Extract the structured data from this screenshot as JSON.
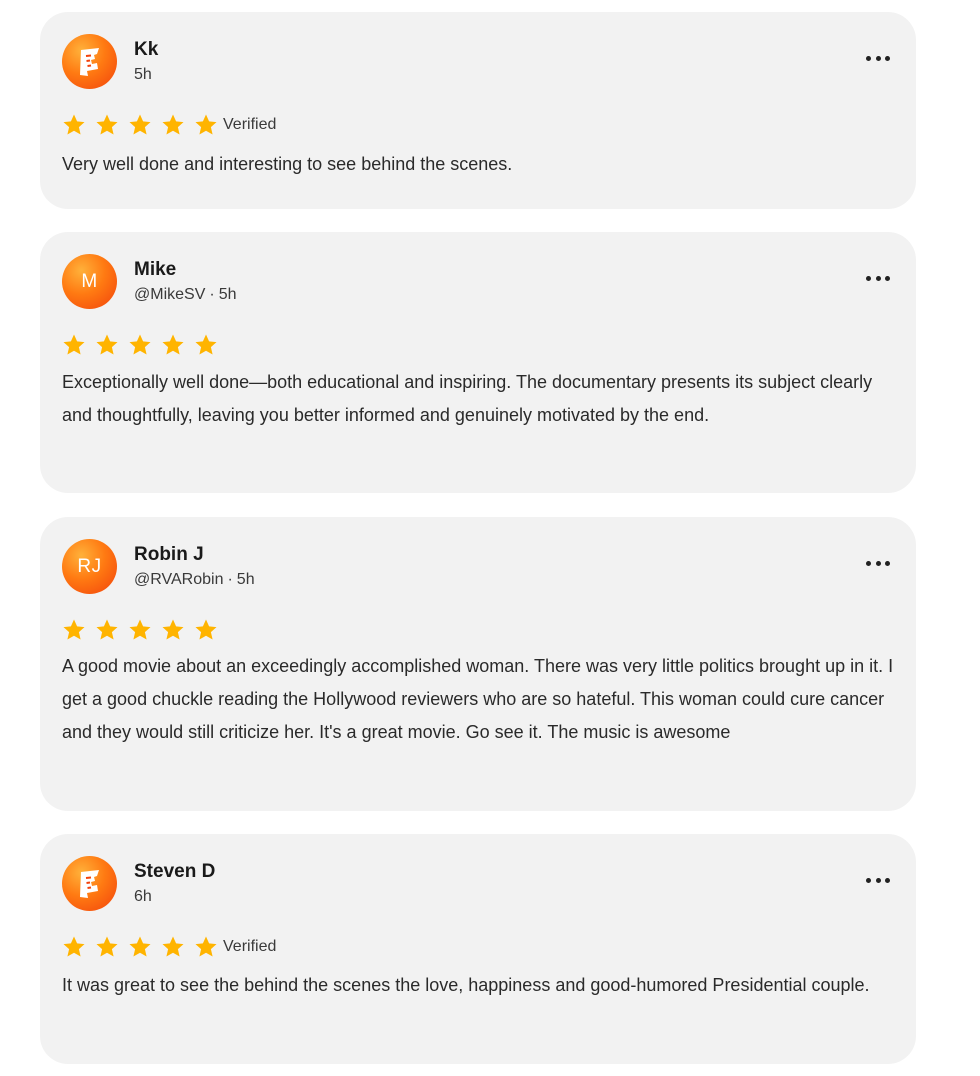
{
  "reviews": [
    {
      "avatar_type": "logo",
      "avatar_icon": "fandango-logo-icon",
      "avatar_initials": "",
      "name": "Kk",
      "handle": "",
      "time": "5h",
      "rating": 5,
      "max_rating": 5,
      "verified_label": "Verified",
      "text": "Very well done and interesting to see behind the scenes."
    },
    {
      "avatar_type": "initials",
      "avatar_icon": "",
      "avatar_initials": "M",
      "name": "Mike",
      "handle": "@MikeSV",
      "time": "5h",
      "rating": 5,
      "max_rating": 5,
      "verified_label": "",
      "text": "Exceptionally well done—both educational and inspiring. The documentary presents its subject clearly and thoughtfully, leaving you better informed and genuinely motivated by the end."
    },
    {
      "avatar_type": "initials",
      "avatar_icon": "",
      "avatar_initials": "RJ",
      "name": "Robin J",
      "handle": "@RVARobin",
      "time": "5h",
      "rating": 5,
      "max_rating": 5,
      "verified_label": "",
      "text": "A good movie about an exceedingly accomplished woman. There was very little politics brought up in it. I get a good chuckle reading the Hollywood reviewers who are so hateful. This woman could cure cancer and they would still criticize her. It's a great movie. Go see it. The music is awesome"
    },
    {
      "avatar_type": "logo",
      "avatar_icon": "fandango-logo-icon",
      "avatar_initials": "",
      "name": "Steven D",
      "handle": "",
      "time": "6h",
      "rating": 5,
      "max_rating": 5,
      "verified_label": "Verified",
      "text": "It was great to see the behind the scenes the love, happiness and good-humored Presidential couple."
    }
  ],
  "meta_separator": "·",
  "colors": {
    "card_background": "#f2f2f2",
    "star": "#ffb400",
    "avatar_orange": "#ff7a12",
    "avatar_red": "#f2420c"
  }
}
